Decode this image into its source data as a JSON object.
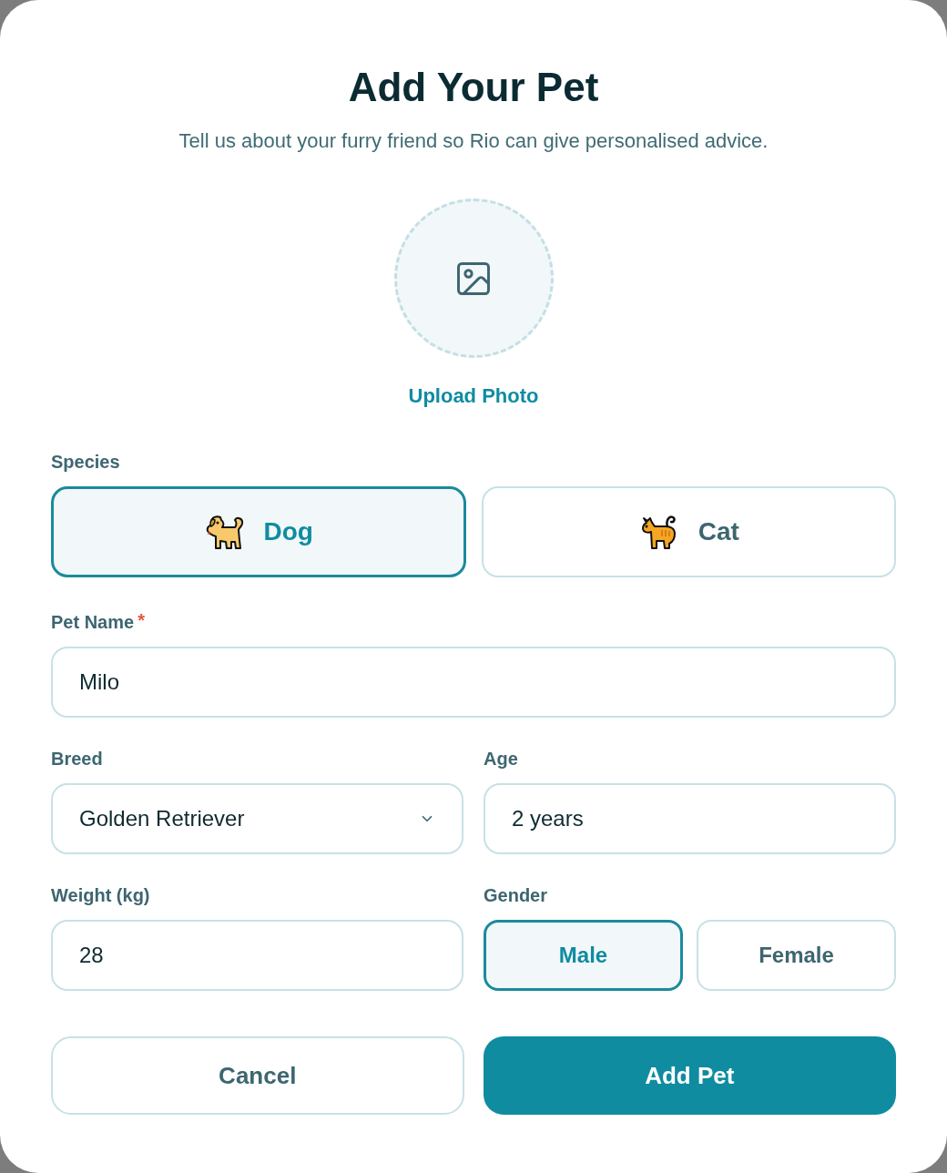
{
  "dialog": {
    "title": "Add Your Pet",
    "subtitle": "Tell us about your furry friend so Rio can give personalised advice."
  },
  "photo_upload": {
    "label": "Upload Photo"
  },
  "species": {
    "label": "Species",
    "options": [
      {
        "label": "Dog",
        "kind": "dog",
        "selected": true
      },
      {
        "label": "Cat",
        "kind": "cat",
        "selected": false
      }
    ]
  },
  "pet_name": {
    "label": "Pet Name",
    "required": true,
    "required_mark": "*",
    "value": "Milo"
  },
  "breed": {
    "label": "Breed",
    "value": "Golden Retriever"
  },
  "age": {
    "label": "Age",
    "value": "2 years"
  },
  "weight": {
    "label": "Weight (kg)",
    "value": "28"
  },
  "gender": {
    "label": "Gender",
    "options": [
      {
        "label": "Male",
        "selected": true
      },
      {
        "label": "Female",
        "selected": false
      }
    ]
  },
  "buttons": [
    {
      "label": "Cancel",
      "kind": "secondary"
    },
    {
      "label": "Add Pet",
      "kind": "primary"
    }
  ]
}
